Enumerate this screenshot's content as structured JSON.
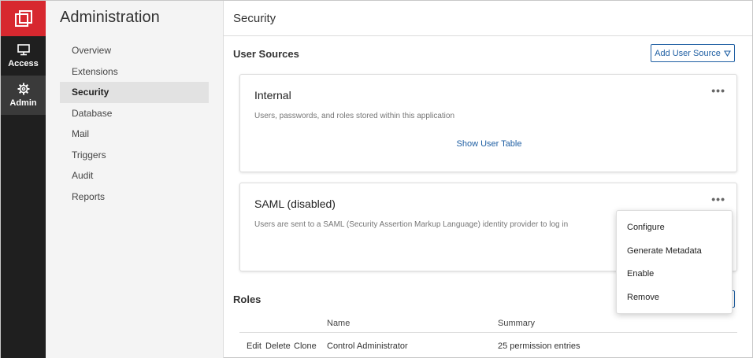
{
  "rail": {
    "items": [
      {
        "label": "Access",
        "icon": "monitor-icon"
      },
      {
        "label": "Admin",
        "icon": "gear-icon"
      }
    ],
    "brand_color": "#d7282f"
  },
  "nav": {
    "title": "Administration",
    "items": [
      "Overview",
      "Extensions",
      "Security",
      "Database",
      "Mail",
      "Triggers",
      "Audit",
      "Reports"
    ],
    "active": "Security"
  },
  "page": {
    "title": "Security"
  },
  "user_sources": {
    "heading": "User Sources",
    "add_button": "Add User Source",
    "cards": [
      {
        "title": "Internal",
        "description": "Users, passwords, and roles stored within this application",
        "link": "Show User Table"
      },
      {
        "title": "SAML (disabled)",
        "description": "Users are sent to a SAML (Security Assertion Markup Language) identity provider to log in"
      }
    ],
    "more_glyph": "•••"
  },
  "context_menu": {
    "items": [
      "Configure",
      "Generate Metadata",
      "Enable",
      "Remove"
    ]
  },
  "roles": {
    "heading": "Roles",
    "columns": [
      "Name",
      "Summary"
    ],
    "rows": [
      {
        "actions": [
          "Edit",
          "Delete",
          "Clone"
        ],
        "name": "Control Administrator",
        "summary": "25 permission entries"
      }
    ]
  }
}
